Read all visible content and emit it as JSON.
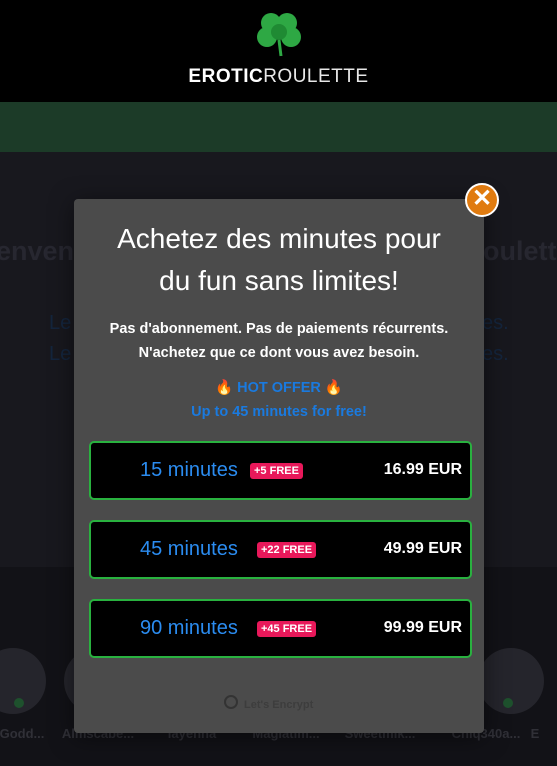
{
  "header": {
    "brand_bold": "EROTIC",
    "brand_light": "ROULETTE",
    "logo_icon": "clover-icon",
    "logo_color": "#2ea844"
  },
  "background": {
    "welcome_left": "enven",
    "welcome_right": "oulette",
    "sub1_left": "Le",
    "sub1_right": "es.",
    "sub2_left": "Le",
    "sub2_right": "es.",
    "users": [
      {
        "name": "Godd..."
      },
      {
        "name": "Almscabe..."
      },
      {
        "name": "layenna"
      },
      {
        "name": "Magiatim..."
      },
      {
        "name": "Sweetmik..."
      },
      {
        "name": "Chiq340a..."
      },
      {
        "name": "E"
      }
    ]
  },
  "modal": {
    "close_label": "✕",
    "title_line1": "Achetez des minutes pour",
    "title_line2": "du fun sans limites!",
    "subtitle_line1": "Pas d'abonnement. Pas de paiements récurrents.",
    "subtitle_line2": "N'achetez que ce dont vous avez besoin.",
    "hot_offer": "HOT OFFER",
    "hot_offer_icon": "fire-icon",
    "free_line": "Up to 45 minutes for free!",
    "plans": [
      {
        "minutes": "15 minutes",
        "badge": "+5 FREE",
        "price": "16.99 EUR"
      },
      {
        "minutes": "45 minutes",
        "badge": "+22 FREE",
        "price": "49.99 EUR"
      },
      {
        "minutes": "90 minutes",
        "badge": "+45 FREE",
        "price": "99.99 EUR"
      }
    ],
    "secure_label": "Let's Encrypt"
  },
  "colors": {
    "accent_green": "#29b13f",
    "accent_blue": "#2b8cf0",
    "badge_pink": "#e8185a",
    "close_orange": "#e07b10"
  }
}
